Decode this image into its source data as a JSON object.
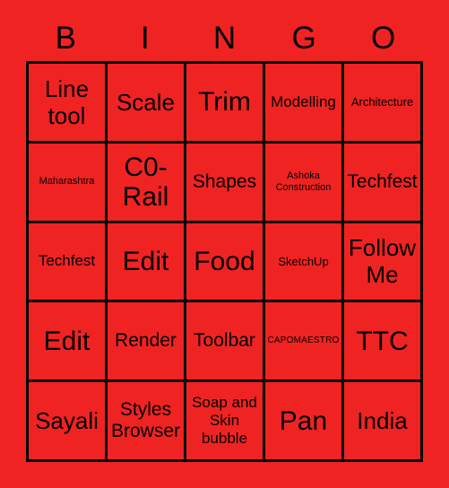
{
  "card": {
    "title_letters": [
      "B",
      "I",
      "N",
      "G",
      "O"
    ],
    "background_color": "#f02323",
    "line_color": "#000000",
    "text_color": "#000000",
    "columns": 5,
    "rows": 5,
    "cells": [
      {
        "text": "Line tool",
        "size": "lg"
      },
      {
        "text": "Scale",
        "size": "lg"
      },
      {
        "text": "Trim",
        "size": "xl"
      },
      {
        "text": "Modelling",
        "size": "sm"
      },
      {
        "text": "Architecture",
        "size": "xs"
      },
      {
        "text": "Maharashtra",
        "size": "xxs"
      },
      {
        "text": "C0-Rail",
        "size": "xl"
      },
      {
        "text": "Shapes",
        "size": "md"
      },
      {
        "text": "Ashoka Construction",
        "size": "xxs"
      },
      {
        "text": "Techfest",
        "size": "md"
      },
      {
        "text": "Techfest",
        "size": "sm"
      },
      {
        "text": "Edit",
        "size": "xl"
      },
      {
        "text": "Food",
        "size": "xl"
      },
      {
        "text": "SketchUp",
        "size": "xs"
      },
      {
        "text": "Follow Me",
        "size": "lg"
      },
      {
        "text": "Edit",
        "size": "xl"
      },
      {
        "text": "Render",
        "size": "md"
      },
      {
        "text": "Toolbar",
        "size": "md"
      },
      {
        "text": "CAPOMAESTRO",
        "size": "caps"
      },
      {
        "text": "TTC",
        "size": "xl"
      },
      {
        "text": "Sayali",
        "size": "lg"
      },
      {
        "text": "Styles Browser",
        "size": "md"
      },
      {
        "text": "Soap and Skin bubble",
        "size": "sm"
      },
      {
        "text": "Pan",
        "size": "xl"
      },
      {
        "text": "India",
        "size": "lg"
      }
    ]
  }
}
